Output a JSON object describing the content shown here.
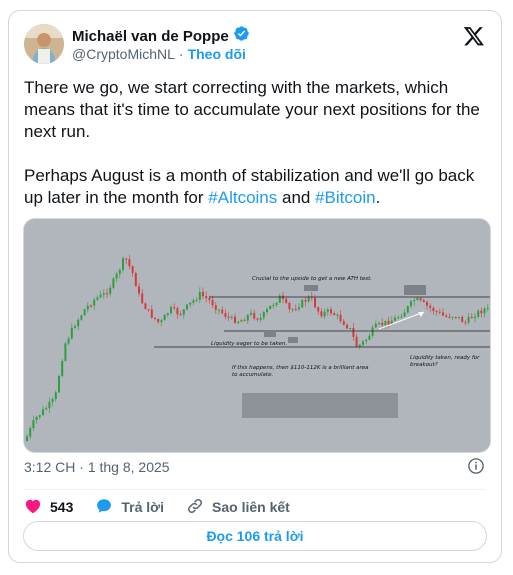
{
  "author": {
    "name": "Michaël van de Poppe",
    "handle": "@CryptoMichNL",
    "separator": "·",
    "follow_label": "Theo dõi"
  },
  "tweet": {
    "line1": "There we go, we start correcting with the markets, which means that it's time to accumulate your next positions for the next run.",
    "line2_prefix": "Perhaps August is a month of stabilization and we'll go back up later in the month for ",
    "hashtag1": "#Altcoins",
    "conjunction": " and ",
    "hashtag2": "#Bitcoin",
    "line2_suffix": "."
  },
  "chart_annotations": {
    "top_label": "Crucial to the upside to get a new ATH test.",
    "liquidity_eager": "Liquidity eager to be taken.",
    "if_happens_1": "If this happens, then $110-112K is a brilliant area",
    "if_happens_2": "to accumulate.",
    "liquidity_taken_1": "Liquidity taken, ready for",
    "liquidity_taken_2": "breakout?"
  },
  "meta": {
    "time": "3:12 CH",
    "dot": "·",
    "date": "1 thg 8, 2025"
  },
  "actions": {
    "likes": "543",
    "reply_label": "Trả lời",
    "copy_link_label": "Sao liên kết"
  },
  "read_replies_label": "Đọc 106 trả lời",
  "colors": {
    "accent": "#1d9bf0",
    "like": "#f91880",
    "candle_up": "#2e9e3e",
    "candle_down": "#d63b3b",
    "chart_bg": "#b0b6bc"
  }
}
